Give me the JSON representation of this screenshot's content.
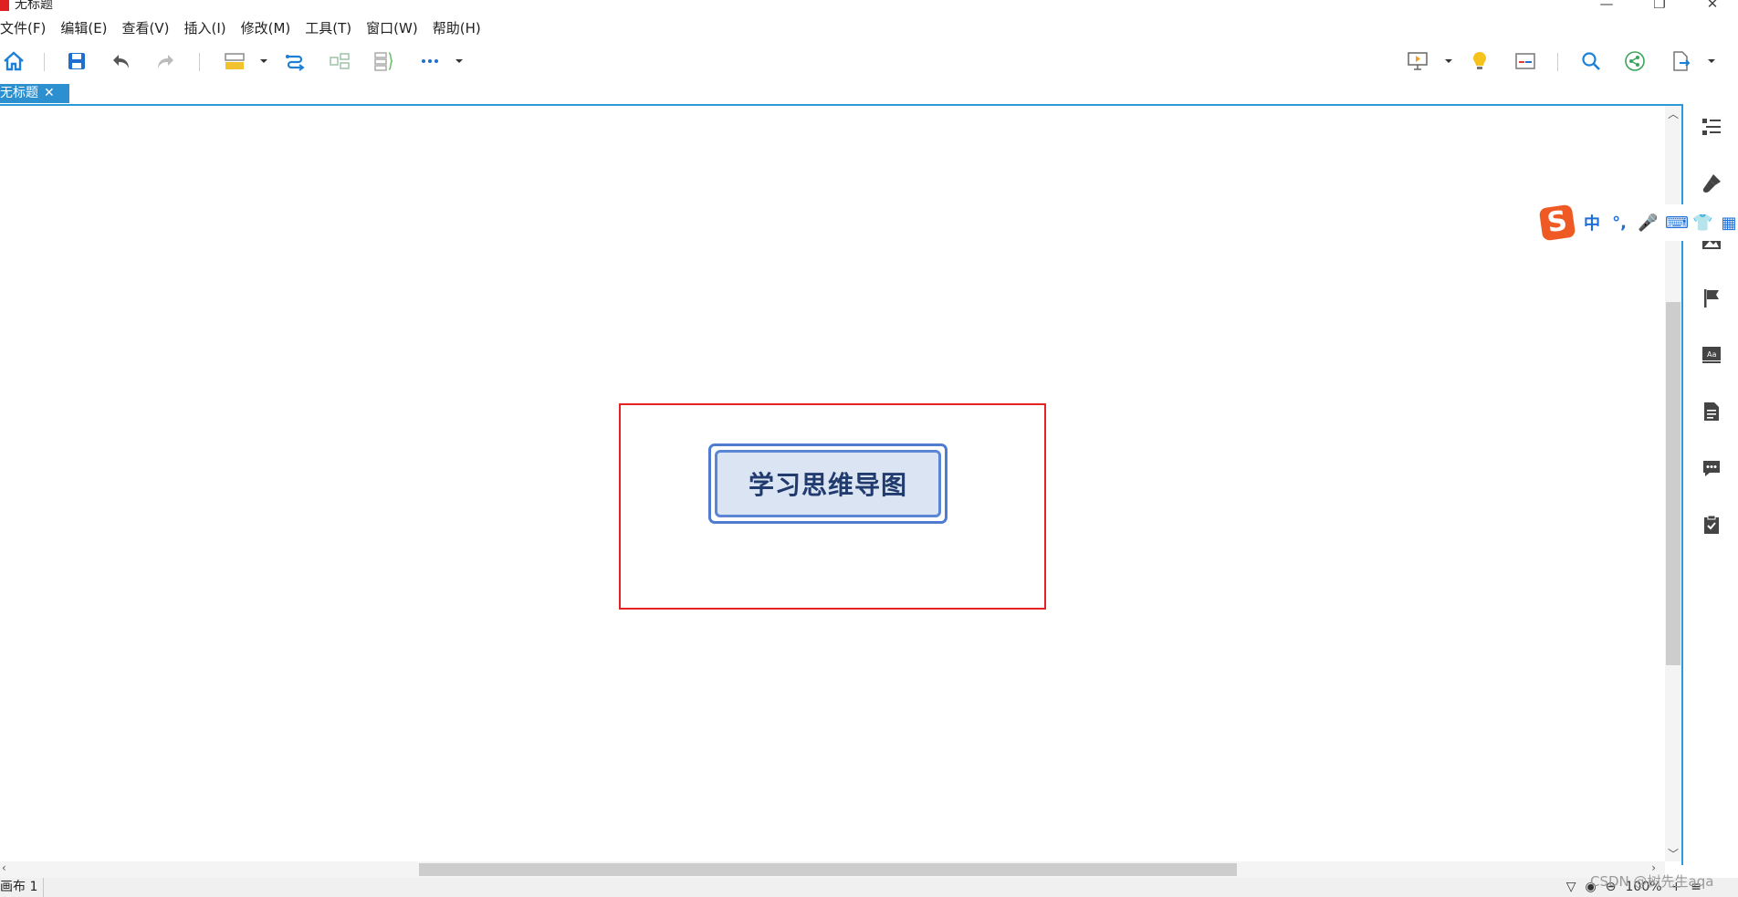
{
  "window": {
    "title": "无标题",
    "controls": {
      "minimize": "—",
      "maximize": "❐",
      "close": "✕"
    }
  },
  "menu": [
    "文件(F)",
    "编辑(E)",
    "查看(V)",
    "插入(I)",
    "修改(M)",
    "工具(T)",
    "窗口(W)",
    "帮助(H)"
  ],
  "toolbar": {
    "left_icons": [
      "home-icon",
      "save-icon",
      "undo-icon",
      "redo-icon",
      "insert-topic-icon",
      "relationship-icon",
      "summary-icon",
      "boundary-icon",
      "more-icon"
    ],
    "right_icons": [
      "presentation-icon",
      "idea-icon",
      "outline-icon",
      "search-icon",
      "share-icon",
      "export-icon"
    ]
  },
  "tabs": [
    {
      "label": "无标题",
      "close": "✕"
    }
  ],
  "canvas": {
    "central_topic": "学习思维导图",
    "selection_color": "#e52323",
    "topic_border_color": "#4f7cd0",
    "topic_fill_color": "#dbe4f3"
  },
  "right_panel": [
    "outline-panel-icon",
    "format-brush-icon",
    "image-icon",
    "marker-flag-icon",
    "text-style-icon",
    "notes-icon",
    "comment-icon",
    "task-icon"
  ],
  "ime": {
    "logo": "S",
    "items": [
      "中",
      "°,",
      "🎤",
      "⌨",
      "👕",
      "▦"
    ]
  },
  "status": {
    "sheet": "画布 1",
    "zoom": "100%",
    "zoom_out": "⊖",
    "zoom_in": "+",
    "filter": "▽",
    "view": "◉",
    "menu": "≡"
  },
  "watermark": "CSDN @树先生aqa",
  "accent_color": "#2b8fd0"
}
